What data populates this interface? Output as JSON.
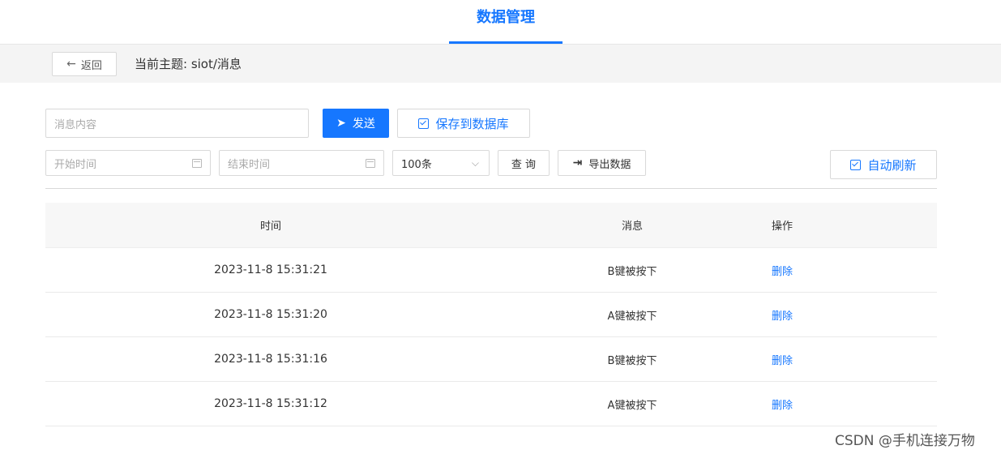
{
  "header": {
    "tab_title": "数据管理"
  },
  "subbar": {
    "back_label": "返回",
    "topic_label": "当前主题: siot/消息"
  },
  "toolbar": {
    "message_placeholder": "消息内容",
    "send_label": "发送",
    "save_label": "保存到数据库",
    "start_time_placeholder": "开始时间",
    "end_time_placeholder": "结束时间",
    "count_value": "100条",
    "query_label": "查 询",
    "export_label": "导出数据",
    "auto_refresh_label": "自动刷新"
  },
  "table": {
    "headers": {
      "time": "时间",
      "message": "消息",
      "action": "操作"
    },
    "rows": [
      {
        "time": "2023-11-8 15:31:21",
        "message": "B键被按下",
        "action": "删除"
      },
      {
        "time": "2023-11-8 15:31:20",
        "message": "A键被按下",
        "action": "删除"
      },
      {
        "time": "2023-11-8 15:31:16",
        "message": "B键被按下",
        "action": "删除"
      },
      {
        "time": "2023-11-8 15:31:12",
        "message": "A键被按下",
        "action": "删除"
      }
    ]
  },
  "watermark": "CSDN @手机连接万物",
  "colors": {
    "accent": "#1677ff",
    "subbar_bg": "#f4f4f4",
    "header_bg": "#f7f7f7"
  }
}
